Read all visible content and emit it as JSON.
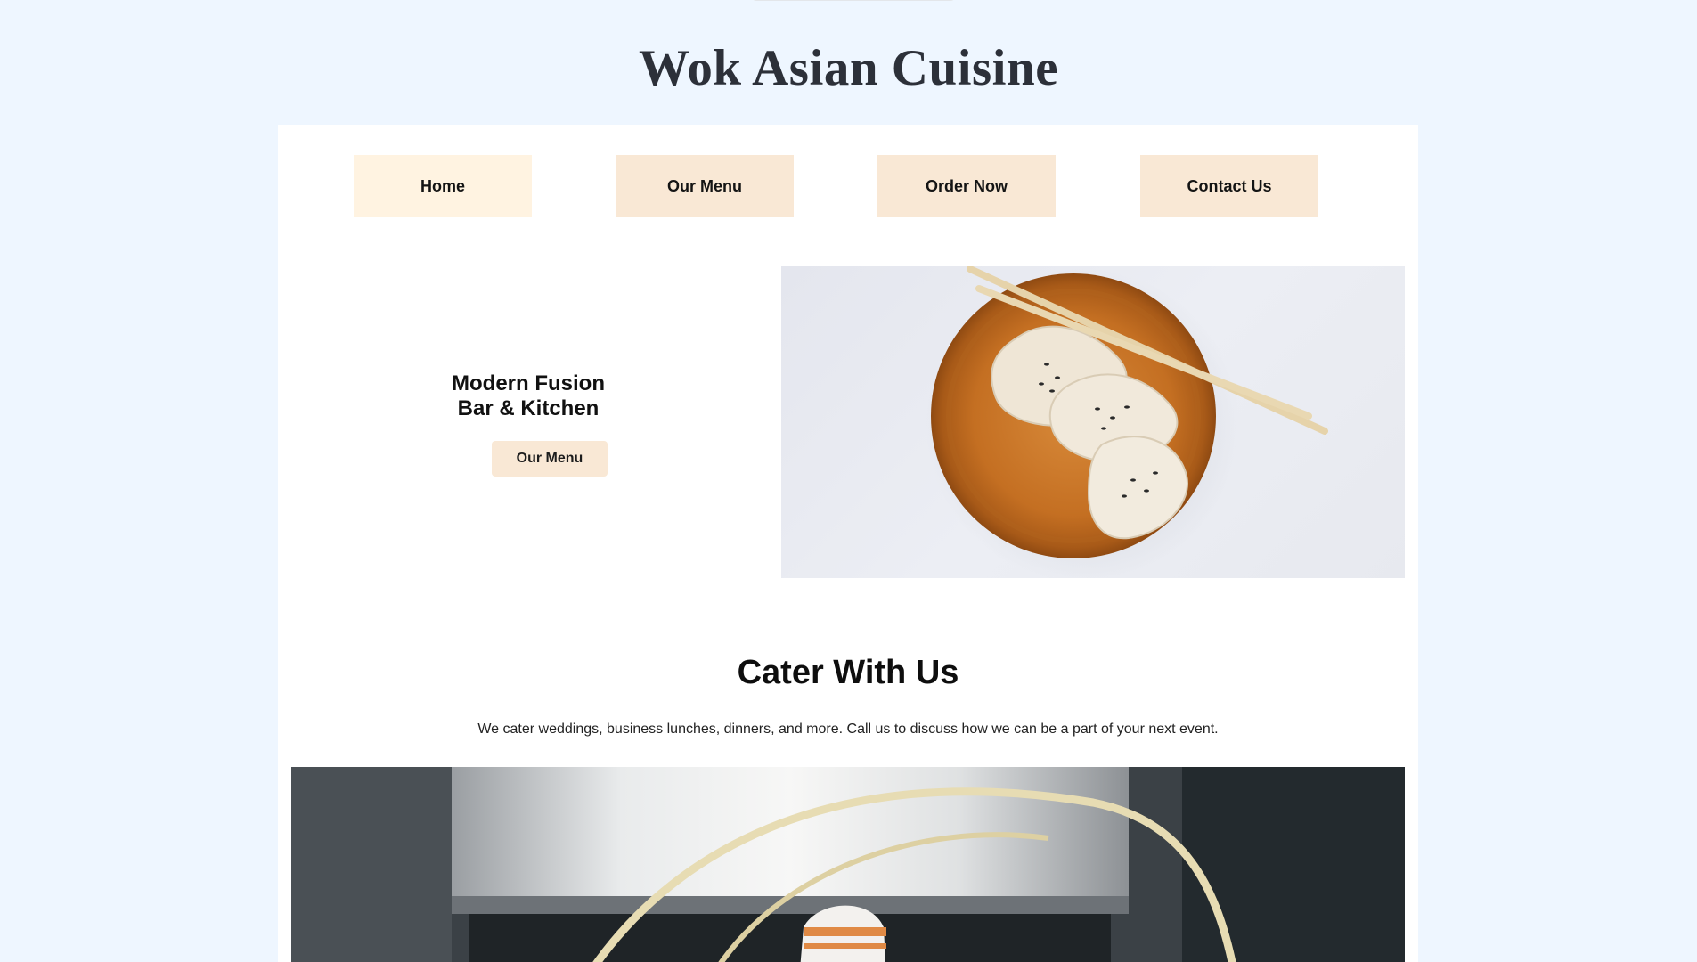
{
  "site": {
    "title": "Wok Asian Cuisine"
  },
  "nav": {
    "items": [
      {
        "label": "Home"
      },
      {
        "label": "Our Menu"
      },
      {
        "label": "Order Now"
      },
      {
        "label": "Contact Us"
      }
    ]
  },
  "hero": {
    "heading_line1": "Modern Fusion",
    "heading_line2": "Bar & Kitchen",
    "button_label": "Our Menu"
  },
  "cater": {
    "heading": "Cater With Us",
    "text": "We cater weddings, business lunches, dinners, and more. Call us to discuss how we can be a part of your next event."
  },
  "colors": {
    "page_background": "#eef6ff",
    "button_background": "#f9e8d5",
    "active_button_background": "#fff3e1",
    "title_color": "#2c3039"
  }
}
